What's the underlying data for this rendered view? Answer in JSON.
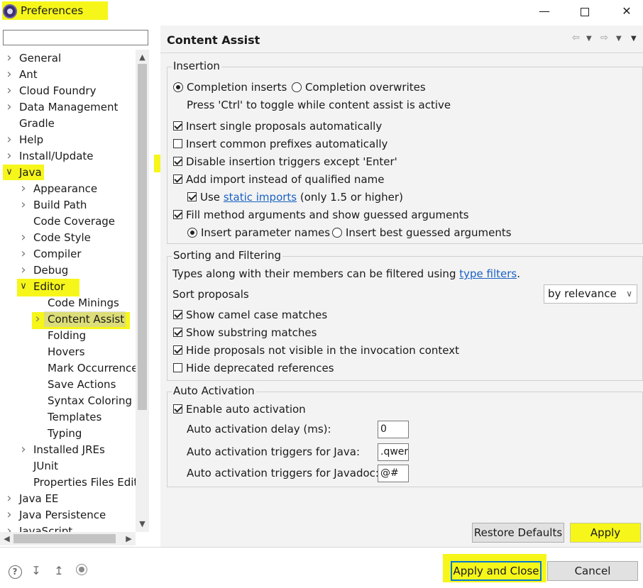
{
  "window": {
    "title": "Preferences",
    "minimize_icon": "minimize-icon",
    "maximize_icon": "maximize-icon",
    "close_icon": "close-icon"
  },
  "filter": {
    "value": "",
    "placeholder": ""
  },
  "tree": [
    {
      "label": "General",
      "expander": "collapsed"
    },
    {
      "label": "Ant",
      "expander": "collapsed"
    },
    {
      "label": "Cloud Foundry",
      "expander": "collapsed"
    },
    {
      "label": "Data Management",
      "expander": "collapsed"
    },
    {
      "label": "Gradle",
      "expander": "none"
    },
    {
      "label": "Help",
      "expander": "collapsed"
    },
    {
      "label": "Install/Update",
      "expander": "collapsed"
    },
    {
      "label": "Java",
      "expander": "expanded"
    },
    {
      "label": "Appearance",
      "expander": "collapsed"
    },
    {
      "label": "Build Path",
      "expander": "collapsed"
    },
    {
      "label": "Code Coverage",
      "expander": "none"
    },
    {
      "label": "Code Style",
      "expander": "collapsed"
    },
    {
      "label": "Compiler",
      "expander": "collapsed"
    },
    {
      "label": "Debug",
      "expander": "collapsed"
    },
    {
      "label": "Editor",
      "expander": "expanded"
    },
    {
      "label": "Code Minings",
      "expander": "none"
    },
    {
      "label": "Content Assist",
      "expander": "collapsed",
      "selected": true
    },
    {
      "label": "Folding",
      "expander": "none"
    },
    {
      "label": "Hovers",
      "expander": "none"
    },
    {
      "label": "Mark Occurrences",
      "expander": "none"
    },
    {
      "label": "Save Actions",
      "expander": "none"
    },
    {
      "label": "Syntax Coloring",
      "expander": "none"
    },
    {
      "label": "Templates",
      "expander": "none"
    },
    {
      "label": "Typing",
      "expander": "none"
    },
    {
      "label": "Installed JREs",
      "expander": "collapsed"
    },
    {
      "label": "JUnit",
      "expander": "none"
    },
    {
      "label": "Properties Files Editor",
      "expander": "none"
    },
    {
      "label": "Java EE",
      "expander": "collapsed"
    },
    {
      "label": "Java Persistence",
      "expander": "collapsed"
    },
    {
      "label": "JavaScript",
      "expander": "collapsed"
    }
  ],
  "page": {
    "title": "Content Assist",
    "back_icon": "back-arrow-icon",
    "forward_icon": "forward-arrow-icon",
    "menu_icon": "view-menu-icon"
  },
  "insertion": {
    "group_label": "Insertion",
    "completion_inserts": "Completion inserts",
    "completion_overwrites": "Completion overwrites",
    "toggle_hint": "Press 'Ctrl' to toggle while content assist is active",
    "single_proposals": "Insert single proposals automatically",
    "common_prefixes": "Insert common prefixes automatically",
    "disable_triggers": "Disable insertion triggers except 'Enter'",
    "add_import": "Add import instead of qualified name",
    "use_prefix": "Use",
    "static_imports_link": "static imports",
    "static_imports_suffix": "(only 1.5 or higher)",
    "fill_args": "Fill method arguments and show guessed arguments",
    "insert_param_names": "Insert parameter names",
    "insert_best_guessed": "Insert best guessed arguments"
  },
  "sorting": {
    "group_label": "Sorting and Filtering",
    "types_text": "Types along with their members can be filtered using",
    "type_filters_link": "type filters",
    "period": ".",
    "sort_proposals_label": "Sort proposals",
    "sort_value": "by relevance",
    "camel_case": "Show camel case matches",
    "substring": "Show substring matches",
    "hide_not_visible": "Hide proposals not visible in the invocation context",
    "hide_deprecated": "Hide deprecated references"
  },
  "auto_activation": {
    "group_label": "Auto Activation",
    "enable": "Enable auto activation",
    "delay_label": "Auto activation delay (ms):",
    "delay_value": "0",
    "java_triggers_label": "Auto activation triggers for Java:",
    "java_triggers_value": ".qwert",
    "javadoc_triggers_label": "Auto activation triggers for Javadoc:",
    "javadoc_triggers_value": "@#"
  },
  "buttons": {
    "restore_defaults": "Restore Defaults",
    "apply": "Apply",
    "apply_and_close": "Apply and Close",
    "cancel": "Cancel"
  },
  "footer_icons": [
    "help-icon",
    "import-icon",
    "export-icon",
    "record-icon"
  ],
  "colors": {
    "highlight": "#f6f61a",
    "link": "#1a62c4",
    "default_button_border": "#0078d7",
    "panel_bg": "#f3f3f3"
  }
}
